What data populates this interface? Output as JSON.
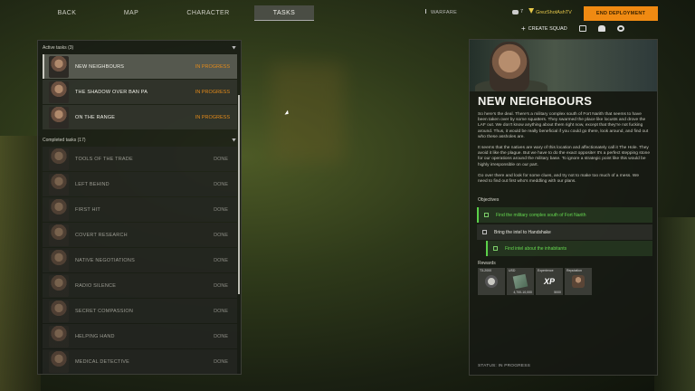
{
  "topbar": {
    "tabs": [
      {
        "label": "BACK"
      },
      {
        "label": "MAP"
      },
      {
        "label": "CHARACTER"
      },
      {
        "label": "TASKS",
        "active": true
      }
    ],
    "warfare_label": "WARFARE",
    "party_count": "7",
    "username": "GrezShotAshTV",
    "deploy_label": "END DEPLOYMENT",
    "create_squad_label": "CREATE SQUAD"
  },
  "active_tasks": {
    "header": "Active tasks (3)",
    "items": [
      {
        "title": "NEW NEIGHBOURS",
        "status": "IN PROGRESS",
        "selected": true
      },
      {
        "title": "THE SHADOW OVER BAN PA",
        "status": "IN PROGRESS"
      },
      {
        "title": "ON THE RANGE",
        "status": "IN PROGRESS"
      }
    ]
  },
  "completed_tasks": {
    "header": "Completed tasks (17)",
    "items": [
      {
        "title": "TOOLS OF THE TRADE",
        "status": "DONE"
      },
      {
        "title": "LEFT BEHIND",
        "status": "DONE"
      },
      {
        "title": "FIRST HIT",
        "status": "DONE"
      },
      {
        "title": "COVERT RESEARCH",
        "status": "DONE"
      },
      {
        "title": "NATIVE NEGOTIATIONS",
        "status": "DONE"
      },
      {
        "title": "RADIO SILENCE",
        "status": "DONE"
      },
      {
        "title": "SECRET COMPASSION",
        "status": "DONE"
      },
      {
        "title": "HELPING HAND",
        "status": "DONE"
      },
      {
        "title": "MEDICAL DETECTIVE",
        "status": "DONE"
      }
    ]
  },
  "detail": {
    "title": "NEW NEIGHBOURS",
    "paragraphs": [
      "So here's the deal. There's a military complex south of Fort Narith that seems to have been taken over by some squatters. They swarmed the place like locusts and drove the LAF out. We don't know anything about them right now, except that they're not fucking around. Thus, it would be really beneficial if you could go there, look around, and find out who these assholes are.",
      "It seems that the natives are wary of this location and affectionately call it The Hole. They avoid it like the plague. But we have to do the exact opposite! It's a perfect stepping stone for our operations around the military base. To ignore a strategic point like this would be highly irresponsible on our part.",
      "Go over there and look for some clues, and try not to make too much of a mess. We need to find out first who's meddling with our plans."
    ],
    "objectives_label": "Objectives",
    "objectives": [
      {
        "text": "Find the military complex south of Fort Narith",
        "complete": true
      },
      {
        "text": "Bring the intel to Handshake",
        "complete": false
      },
      {
        "text": "Find intel about the inhabitants",
        "complete": true
      }
    ],
    "rewards_label": "Rewards",
    "rewards": [
      {
        "label": "T3-2000",
        "qty": "",
        "icon": "vest-icon"
      },
      {
        "label": "USD",
        "qty": "4,700-10,000",
        "icon": "cash-icon"
      },
      {
        "label": "Experience",
        "qty": "5000",
        "icon": "xp-icon"
      },
      {
        "label": "Reputation",
        "qty": "",
        "icon": "reputation-icon"
      }
    ],
    "status_text": "STATUS: IN PROGRESS"
  },
  "colors": {
    "accent_orange": "#f08a12",
    "progress": "#e38a1a",
    "objective_done": "#5bd04a",
    "username": "#e7c94a"
  }
}
